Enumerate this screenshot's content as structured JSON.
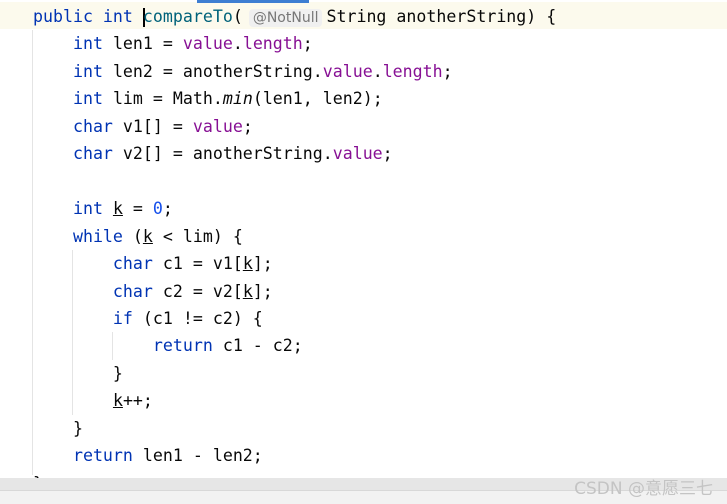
{
  "colors": {
    "keyword": "#0033b3",
    "field": "#871094",
    "method": "#00627a",
    "number": "#1750eb",
    "current_line": "#fcfaed"
  },
  "code": [
    [
      {
        "t": "public int ",
        "c": "kw"
      },
      {
        "t": "",
        "c": "caret"
      },
      {
        "t": "compareTo",
        "c": "fn"
      },
      {
        "t": "(",
        "c": ""
      },
      {
        "t": "@NotNull",
        "c": "hint"
      },
      {
        "t": "String anotherString) {",
        "c": ""
      }
    ],
    [
      {
        "t": "    int ",
        "c": "kw"
      },
      {
        "t": "len1 = ",
        "c": ""
      },
      {
        "t": "value",
        "c": "fld"
      },
      {
        "t": ".",
        "c": ""
      },
      {
        "t": "length",
        "c": "fld"
      },
      {
        "t": ";",
        "c": ""
      }
    ],
    [
      {
        "t": "    int ",
        "c": "kw"
      },
      {
        "t": "len2 = anotherString.",
        "c": ""
      },
      {
        "t": "value",
        "c": "fld"
      },
      {
        "t": ".",
        "c": ""
      },
      {
        "t": "length",
        "c": "fld"
      },
      {
        "t": ";",
        "c": ""
      }
    ],
    [
      {
        "t": "    int ",
        "c": "kw"
      },
      {
        "t": "lim = Math.",
        "c": ""
      },
      {
        "t": "min",
        "c": "it"
      },
      {
        "t": "(len1, len2);",
        "c": ""
      }
    ],
    [
      {
        "t": "    char ",
        "c": "kw"
      },
      {
        "t": "v1[] = ",
        "c": ""
      },
      {
        "t": "value",
        "c": "fld"
      },
      {
        "t": ";",
        "c": ""
      }
    ],
    [
      {
        "t": "    char ",
        "c": "kw"
      },
      {
        "t": "v2[] = anotherString.",
        "c": ""
      },
      {
        "t": "value",
        "c": "fld"
      },
      {
        "t": ";",
        "c": ""
      }
    ],
    [],
    [
      {
        "t": "    int ",
        "c": "kw"
      },
      {
        "t": "k",
        "c": "ul"
      },
      {
        "t": " = ",
        "c": ""
      },
      {
        "t": "0",
        "c": "num"
      },
      {
        "t": ";",
        "c": ""
      }
    ],
    [
      {
        "t": "    while ",
        "c": "kw"
      },
      {
        "t": "(",
        "c": ""
      },
      {
        "t": "k",
        "c": "ul"
      },
      {
        "t": " < lim) {",
        "c": ""
      }
    ],
    [
      {
        "t": "        char ",
        "c": "kw"
      },
      {
        "t": "c1 = v1[",
        "c": ""
      },
      {
        "t": "k",
        "c": "ul"
      },
      {
        "t": "];",
        "c": ""
      }
    ],
    [
      {
        "t": "        char ",
        "c": "kw"
      },
      {
        "t": "c2 = v2[",
        "c": ""
      },
      {
        "t": "k",
        "c": "ul"
      },
      {
        "t": "];",
        "c": ""
      }
    ],
    [
      {
        "t": "        if ",
        "c": "kw"
      },
      {
        "t": "(c1 != c2) {",
        "c": ""
      }
    ],
    [
      {
        "t": "            return ",
        "c": "kw"
      },
      {
        "t": "c1 - c2;",
        "c": ""
      }
    ],
    [
      {
        "t": "        }",
        "c": ""
      }
    ],
    [
      {
        "t": "        ",
        "c": ""
      },
      {
        "t": "k",
        "c": "ul"
      },
      {
        "t": "++;",
        "c": ""
      }
    ],
    [
      {
        "t": "    }",
        "c": ""
      }
    ],
    [
      {
        "t": "    return ",
        "c": "kw"
      },
      {
        "t": "len1 - len2;",
        "c": ""
      }
    ],
    [
      {
        "t": "}",
        "c": ""
      }
    ]
  ],
  "watermark": "CSDN @意愿三七"
}
